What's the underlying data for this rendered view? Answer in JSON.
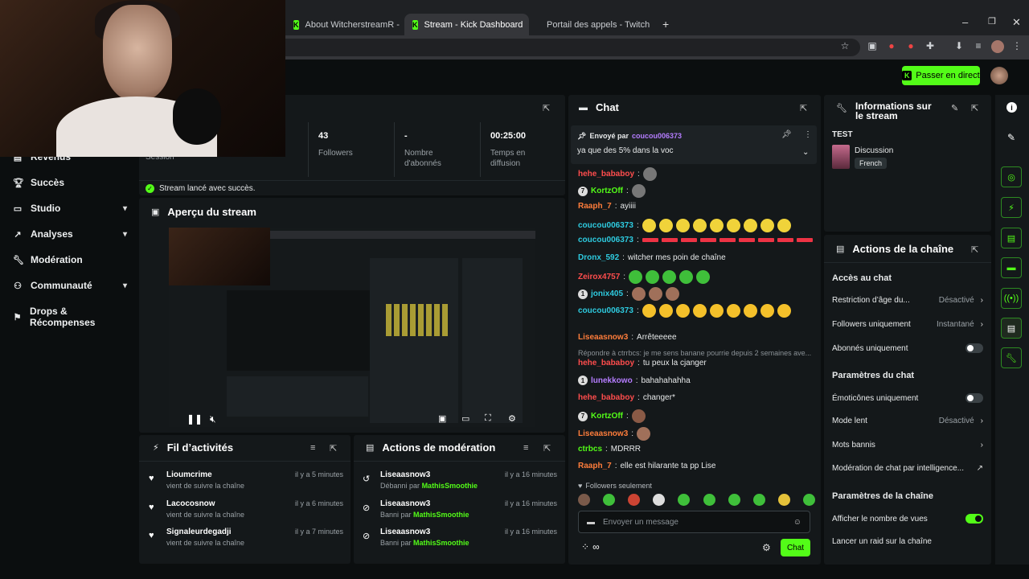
{
  "browser": {
    "tabs": [
      {
        "title": "About WitcherstreamR - Watch",
        "close": "✕"
      },
      {
        "title": "Stream - Kick Dashboard",
        "close": "✕"
      },
      {
        "title": "Portail des appels - Twitch",
        "close": "✕"
      }
    ],
    "new_tab": "+"
  },
  "topbar": {
    "go_live": "Passer en direct"
  },
  "sidebar": {
    "items": [
      {
        "label": "Revenus"
      },
      {
        "label": "Succès"
      },
      {
        "label": "Studio",
        "chevron": "▾"
      },
      {
        "label": "Analyses",
        "chevron": "▾"
      },
      {
        "label": "Modération"
      },
      {
        "label": "Communauté",
        "chevron": "▾"
      },
      {
        "label": "Drops & Récompenses"
      }
    ]
  },
  "stats": {
    "session_label": "Session",
    "items": [
      {
        "value": "43",
        "label": "Followers"
      },
      {
        "value": "-",
        "label": "Nombre d'abonnés"
      },
      {
        "value": "00:25:00",
        "label": "Temps en diffusion"
      }
    ],
    "success_message": "Stream lancé avec succès."
  },
  "preview": {
    "title": "Aperçu du stream"
  },
  "activity": {
    "title": "Fil d’activités",
    "rows": [
      {
        "name": "Lioumcrime",
        "sub": "vient de suivre la chaîne",
        "time": "il y a 5 minutes"
      },
      {
        "name": "Lacocosnow",
        "sub": "vient de suivre la chaîne",
        "time": "il y a 6 minutes"
      },
      {
        "name": "Signaleurdegadji",
        "sub": "vient de suivre la chaîne",
        "time": "il y a 7 minutes"
      }
    ]
  },
  "moderation": {
    "title": "Actions de modération",
    "rows": [
      {
        "name": "Liseaasnow3",
        "action": "Débanni par",
        "by": "MathisSmoothie",
        "time": "il y a 16 minutes"
      },
      {
        "name": "Liseaasnow3",
        "action": "Banni par",
        "by": "MathisSmoothie",
        "time": "il y a 16 minutes"
      },
      {
        "name": "Liseaasnow3",
        "action": "Banni par",
        "by": "MathisSmoothie",
        "time": "il y a 16 minutes"
      }
    ]
  },
  "chat": {
    "title": "Chat",
    "pinned": {
      "sent_by": "Envoyé par",
      "user": "coucou006373",
      "text": "ya que des 5% dans la voc"
    },
    "messages": [
      {
        "user": "hehe_bababoy",
        "color": "#ff4d4d",
        "text": ""
      },
      {
        "user": "KortzOff",
        "color": "#53fc18",
        "text": ""
      },
      {
        "user": "Raaph_7",
        "color": "#ff7d3b",
        "text": "ayiiii"
      },
      {
        "user": "coucou006373",
        "color": "#2ecbe0",
        "text": ""
      },
      {
        "user": "coucou006373",
        "color": "#2ecbe0",
        "text": ""
      },
      {
        "user": "Dronx_592",
        "color": "#2ecbe0",
        "text": "witcher mes poin de chaîne"
      },
      {
        "user": "Zeirox4757",
        "color": "#ff4d4d",
        "text": ""
      },
      {
        "user": "jonix405",
        "color": "#2ecbe0",
        "text": ""
      },
      {
        "user": "coucou006373",
        "color": "#2ecbe0",
        "text": ""
      },
      {
        "user": "Liseaasnow3",
        "color": "#ff7d3b",
        "text": "Arrêteeeee"
      },
      {
        "user": "hehe_bababoy",
        "color": "#ff4d4d",
        "text": "tu peux la cjanger"
      },
      {
        "user": "lunekkowo",
        "color": "#b57dff",
        "text": "bahahahahha"
      },
      {
        "user": "hehe_bababoy",
        "color": "#ff4d4d",
        "text": "changer*"
      },
      {
        "user": "KortzOff",
        "color": "#53fc18",
        "text": ""
      },
      {
        "user": "Liseaasnow3",
        "color": "#ff7d3b",
        "text": ""
      },
      {
        "user": "ctrbcs",
        "color": "#53fc18",
        "text": "MDRRR"
      },
      {
        "user": "Raaph_7",
        "color": "#ff7d3b",
        "text": "elle est hilarante ta pp Lise"
      }
    ],
    "reply_preview": "Répondre à ctrrbcs: je me sens banane pourrie depuis 2 semaines ave...",
    "followers_only": "Followers seulement",
    "input_placeholder": "Envoyer un message",
    "send": "Chat",
    "infinity": "∞"
  },
  "stream_info": {
    "title": "Informations sur le stream",
    "stream_title": "TEST",
    "category": "Discussion",
    "language": "French"
  },
  "channel_actions": {
    "title": "Actions de la chaîne",
    "sec_access": "Accès au chat",
    "age_restriction": {
      "label": "Restriction d’âge du...",
      "value": "Désactivé"
    },
    "followers_only": {
      "label": "Followers uniquement",
      "value": "Instantané"
    },
    "subs_only": {
      "label": "Abonnés uniquement"
    },
    "sec_params": "Paramètres du chat",
    "emotes_only": {
      "label": "Émoticônes uniquement"
    },
    "slow_mode": {
      "label": "Mode lent",
      "value": "Désactivé"
    },
    "banned_words": {
      "label": "Mots bannis"
    },
    "ai_moderation": {
      "label": "Modération de chat par intelligence..."
    },
    "sec_channel": "Paramètres de la chaîne",
    "show_views": {
      "label": "Afficher le nombre de vues"
    },
    "raid": {
      "label": "Lancer un raid sur la chaîne"
    }
  }
}
